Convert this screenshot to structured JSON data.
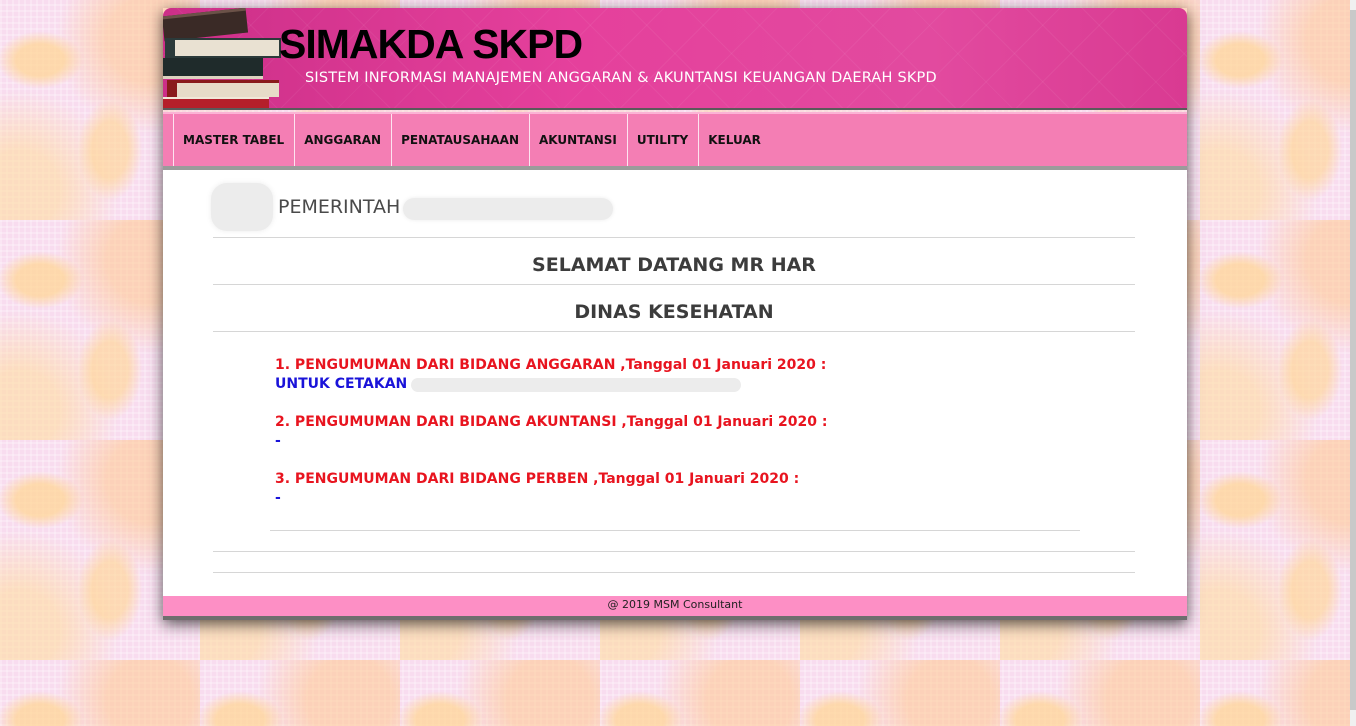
{
  "header": {
    "title": "SIMAKDA SKPD",
    "subtitle": "SISTEM INFORMASI MANAJEMEN ANGGARAN & AKUNTANSI KEUANGAN DAERAH SKPD",
    "logo_icon": "books-icon"
  },
  "nav": {
    "items": [
      {
        "label": "MASTER TABEL"
      },
      {
        "label": "ANGGARAN"
      },
      {
        "label": "PENATAUSAHAAN"
      },
      {
        "label": "AKUNTANSI"
      },
      {
        "label": "UTILITY"
      },
      {
        "label": "KELUAR"
      }
    ]
  },
  "main": {
    "org_prefix": "PEMERINTAH",
    "welcome": "SELAMAT DATANG MR HAR",
    "department": "DINAS KESEHATAN",
    "announcements": [
      {
        "title": "1. PENGUMUMAN DARI BIDANG ANGGARAN ,Tanggal 01 Januari 2020 :",
        "body": "UNTUK CETAKAN"
      },
      {
        "title": "2. PENGUMUMAN DARI BIDANG AKUNTANSI ,Tanggal 01 Januari 2020 :",
        "body": "-"
      },
      {
        "title": "3. PENGUMUMAN DARI BIDANG PERBEN ,Tanggal 01 Januari 2020 :",
        "body": "-"
      }
    ]
  },
  "footer": {
    "text": "@ 2019 MSM Consultant"
  },
  "colors": {
    "header_pink": "#e5409c",
    "nav_pink": "#f47eb4",
    "footer_pink": "#fd8fc5",
    "announcement_title": "#e8141f",
    "announcement_body": "#1a13d9"
  }
}
